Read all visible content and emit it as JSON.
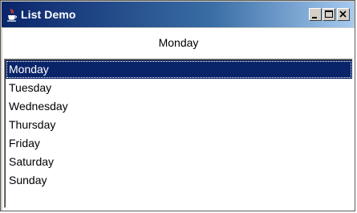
{
  "window": {
    "title": "List Demo",
    "icon": "java-cup-icon",
    "controls": {
      "minimize": "minimize-icon",
      "maximize": "maximize-icon",
      "close": "close-icon"
    }
  },
  "selection_label": "Monday",
  "list": {
    "items": [
      {
        "label": "Monday",
        "selected": true
      },
      {
        "label": "Tuesday",
        "selected": false
      },
      {
        "label": "Wednesday",
        "selected": false
      },
      {
        "label": "Thursday",
        "selected": false
      },
      {
        "label": "Friday",
        "selected": false
      },
      {
        "label": "Saturday",
        "selected": false
      },
      {
        "label": "Sunday",
        "selected": false
      }
    ]
  },
  "colors": {
    "titlebar_start": "#0a246a",
    "titlebar_end": "#a6caf0",
    "selection_bg": "#0a246a",
    "selection_text": "#ffffff",
    "window_face": "#d4d0c8"
  }
}
